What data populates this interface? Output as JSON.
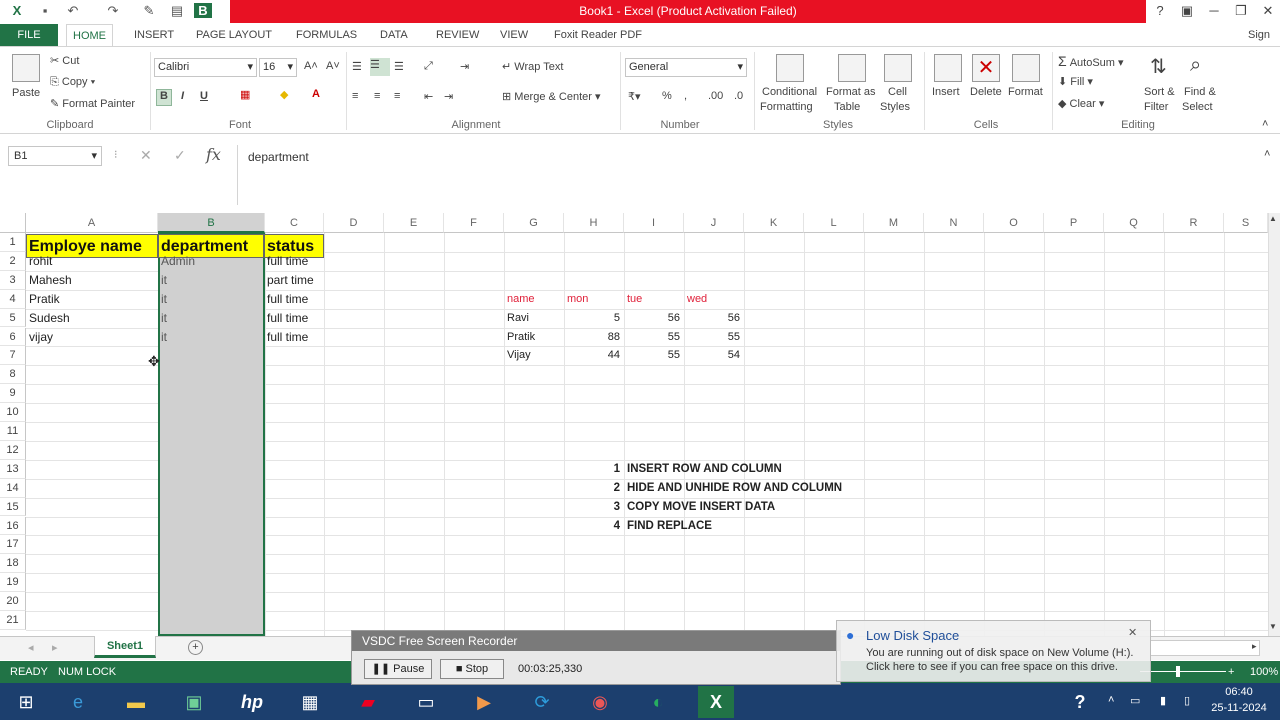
{
  "window": {
    "title": "Book1 - Excel (Product Activation Failed)",
    "help": "?",
    "sign_in": "Sign i"
  },
  "tabs": [
    "FILE",
    "HOME",
    "INSERT",
    "PAGE LAYOUT",
    "FORMULAS",
    "DATA",
    "REVIEW",
    "VIEW",
    "Foxit Reader PDF"
  ],
  "clipboard": {
    "paste": "Paste",
    "cut": "Cut",
    "copy": "Copy",
    "format_painter": "Format Painter",
    "label": "Clipboard"
  },
  "font": {
    "name": "Calibri",
    "size": "16",
    "bold": "B",
    "italic": "I",
    "underline": "U",
    "label": "Font"
  },
  "alignment": {
    "wrap": "Wrap Text",
    "merge": "Merge & Center",
    "label": "Alignment"
  },
  "number": {
    "format": "General",
    "percent": "%",
    "label": "Number"
  },
  "styles": {
    "conditional": "Conditional",
    "conditional2": "Formatting",
    "format_table": "Format as",
    "format_table2": "Table",
    "cell_styles": "Cell",
    "cell_styles2": "Styles",
    "label": "Styles"
  },
  "cells": {
    "insert": "Insert",
    "delete": "Delete",
    "format": "Format",
    "label": "Cells"
  },
  "editing": {
    "autosum": "AutoSum",
    "fill": "Fill",
    "clear": "Clear",
    "sort": "Sort &",
    "sort2": "Filter",
    "find": "Find &",
    "find2": "Select",
    "label": "Editing"
  },
  "formula_bar": {
    "name_box": "B1",
    "fx": "fx",
    "content": "department"
  },
  "columns": [
    "A",
    "B",
    "C",
    "D",
    "E",
    "F",
    "G",
    "H",
    "I",
    "J",
    "K",
    "L",
    "M",
    "N",
    "O",
    "P",
    "Q",
    "R",
    "S"
  ],
  "rows": [
    "1",
    "2",
    "3",
    "4",
    "5",
    "6",
    "7",
    "8",
    "9",
    "10",
    "11",
    "12",
    "13",
    "14",
    "15",
    "16",
    "17",
    "18",
    "19",
    "20",
    "21"
  ],
  "table1": {
    "headers": [
      "Employe name",
      "department",
      "status"
    ],
    "rows": [
      [
        "rohit",
        "Admin",
        "full time"
      ],
      [
        "Mahesh",
        "it",
        "part time"
      ],
      [
        "Pratik",
        "it",
        "full time"
      ],
      [
        "Sudesh",
        "it",
        "full time"
      ],
      [
        "vijay",
        "it",
        "full time"
      ]
    ]
  },
  "table2": {
    "headers": [
      "name",
      "mon",
      "tue",
      "wed"
    ],
    "rows": [
      [
        "Ravi",
        "5",
        "56",
        "56"
      ],
      [
        "Pratik",
        "88",
        "55",
        "55"
      ],
      [
        "Vijay",
        "44",
        "55",
        "54"
      ]
    ]
  },
  "notes": [
    [
      "1",
      "INSERT ROW AND COLUMN"
    ],
    [
      "2",
      "HIDE AND UNHIDE ROW AND COLUMN"
    ],
    [
      "3",
      "COPY MOVE INSERT DATA"
    ],
    [
      "4",
      "FIND REPLACE"
    ]
  ],
  "sheet_tab": "Sheet1",
  "status": {
    "ready": "READY",
    "numlock": "NUM LOCK",
    "zoom": "100%"
  },
  "recorder": {
    "title": "VSDC Free Screen Recorder",
    "pause": "Pause",
    "stop": "Stop",
    "time": "00:03:25,330"
  },
  "notification": {
    "title": "Low Disk Space",
    "line1": "You are running out of disk space on New Volume (H:).",
    "line2": "Click here to see if you can free space on this drive."
  },
  "clock": {
    "time": "06:40",
    "date": "25-11-2024"
  },
  "colors": {
    "excel_green": "#217346",
    "title_red": "#e81123",
    "header_yellow": "#ffff00",
    "selection_gray": "#d0d0d0"
  }
}
